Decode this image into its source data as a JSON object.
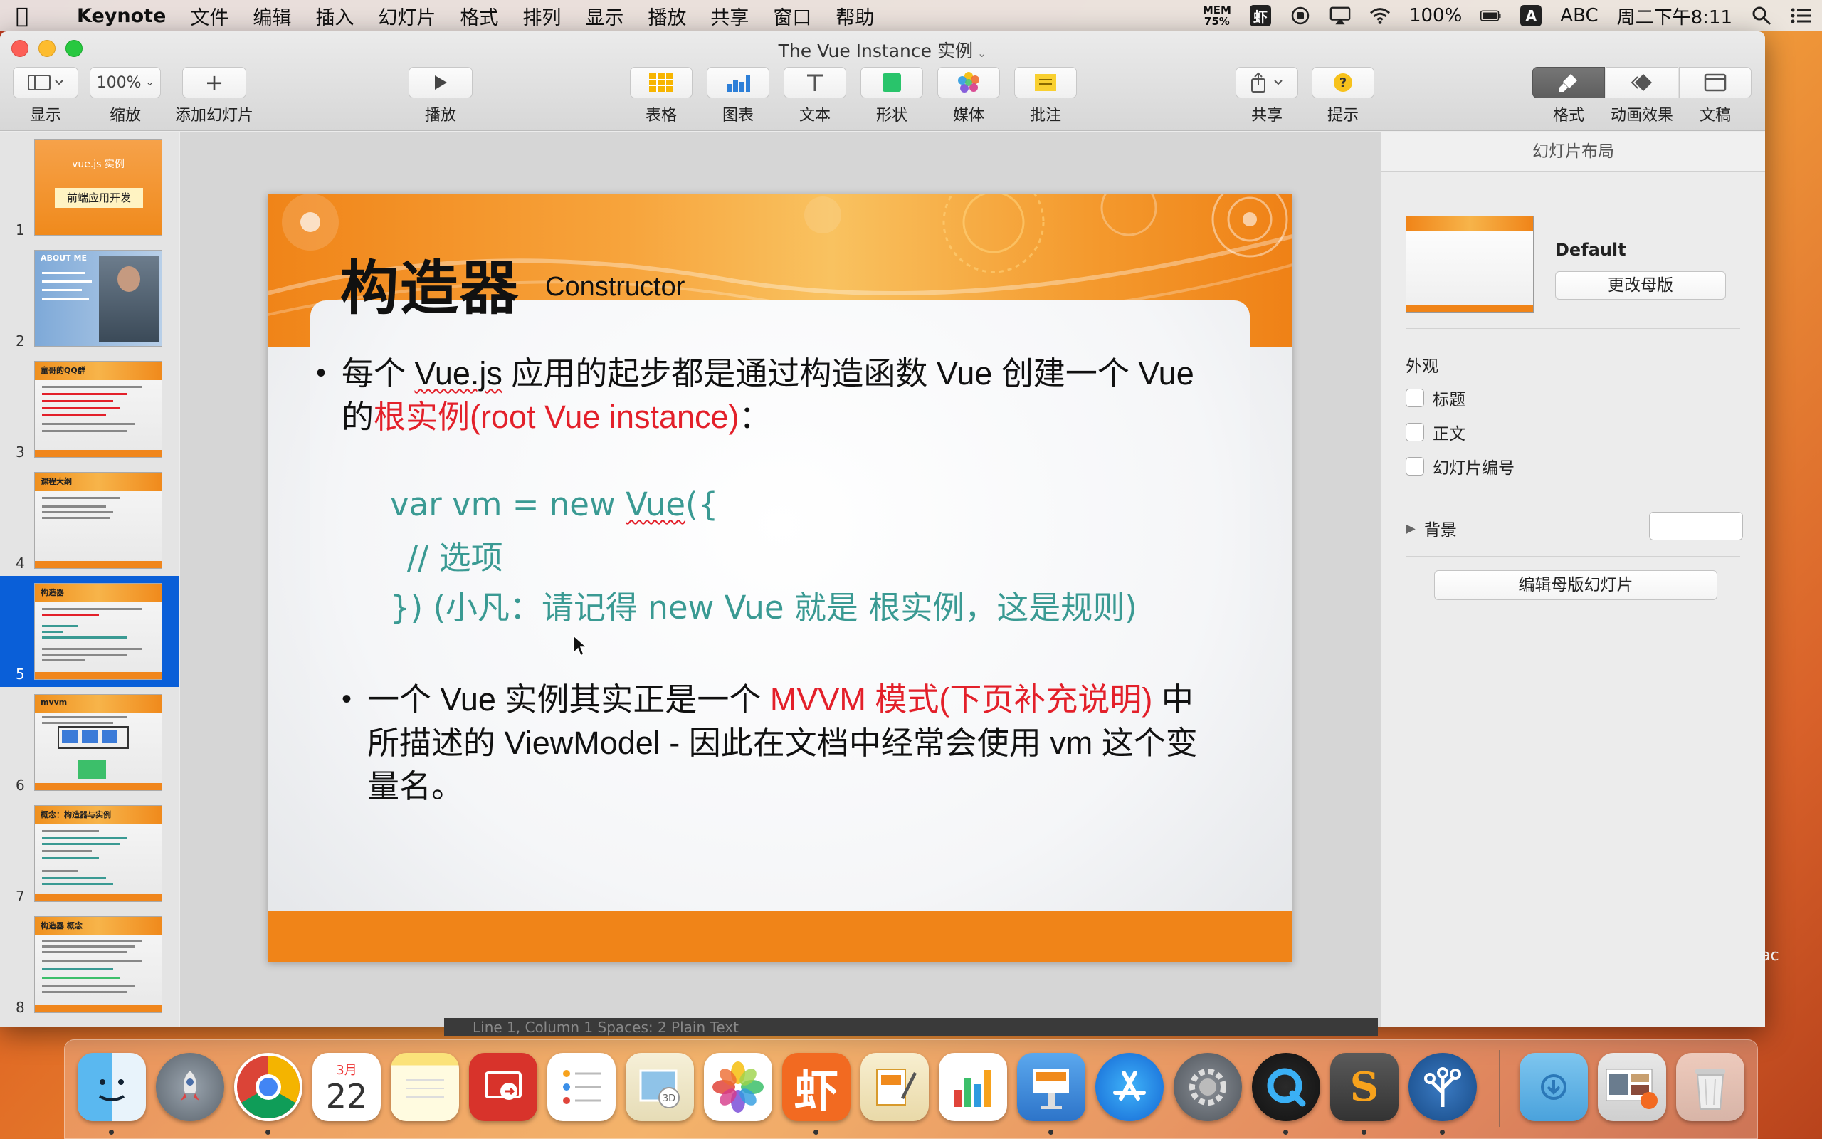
{
  "menubar": {
    "app_name": "Keynote",
    "items": [
      "文件",
      "编辑",
      "插入",
      "幻灯片",
      "格式",
      "排列",
      "显示",
      "播放",
      "共享",
      "窗口",
      "帮助"
    ],
    "mem_label": "MEM",
    "mem_value": "75%",
    "battery": "100%",
    "input_source": "ABC",
    "input_badge": "A",
    "clock": "周二下午8:11"
  },
  "window": {
    "title": "The Vue Instance 实例"
  },
  "toolbar": {
    "view_label": "显示",
    "zoom_value": "100%",
    "zoom_label": "缩放",
    "add_slide_label": "添加幻灯片",
    "play_label": "播放",
    "table_label": "表格",
    "chart_label": "图表",
    "text_label": "文本",
    "shape_label": "形状",
    "media_label": "媒体",
    "comment_label": "批注",
    "share_label": "共享",
    "tips_label": "提示",
    "format_label": "格式",
    "animate_label": "动画效果",
    "document_label": "文稿"
  },
  "navigator": {
    "slides": [
      {
        "num": "1",
        "title": "vue.js 实例",
        "sub": "前端应用开发"
      },
      {
        "num": "2",
        "title": "ABOUT ME"
      },
      {
        "num": "3",
        "title": "童哥的QQ群"
      },
      {
        "num": "4",
        "title": "课程大纲"
      },
      {
        "num": "5",
        "title": "构造器"
      },
      {
        "num": "6",
        "title": "mvvm"
      },
      {
        "num": "7",
        "title": "概念：构造器与实例"
      },
      {
        "num": "8",
        "title": "构造器 概念"
      }
    ],
    "selected_index": 4
  },
  "slide": {
    "title": "构造器",
    "subtitle": "Constructor",
    "bullet1_a": "每个 ",
    "bullet1_vuejs": "Vue.js",
    "bullet1_b": " 应用的起步都是通过构造函数 Vue 创建一个 Vue 的",
    "bullet1_red": "根实例(root Vue instance)",
    "bullet1_c": "：",
    "code_line1_a": "var vm = new ",
    "code_line1_vue": "Vue",
    "code_line1_b": "({",
    "code_line2": "// 选项",
    "code_line3": "}) (小凡：请记得 new Vue 就是 根实例，这是规则)",
    "bullet2_a": "一个 Vue 实例其实正是一个 ",
    "bullet2_red": "MVVM 模式(下页补充说明)",
    "bullet2_b": " 中所描述的 ViewModel - 因此在文档中经常会使用 vm 这个变量名。"
  },
  "inspector": {
    "header": "幻灯片布局",
    "master_name": "Default",
    "change_master": "更改母版",
    "appearance": "外观",
    "checks": [
      "标题",
      "正文",
      "幻灯片编号"
    ],
    "background": "背景",
    "edit_master": "编辑母版幻灯片"
  },
  "peek": {
    "text": "Line 1, Column 1          Spaces: 2          Plain Text",
    "right_text": "ac"
  },
  "dock": {
    "calendar_month": "3月",
    "calendar_day": "22"
  },
  "colors": {
    "accent_orange": "#f08418",
    "red_text": "#e3202a",
    "code_teal": "#3a9a93",
    "selection_blue": "#0a5fd8"
  }
}
